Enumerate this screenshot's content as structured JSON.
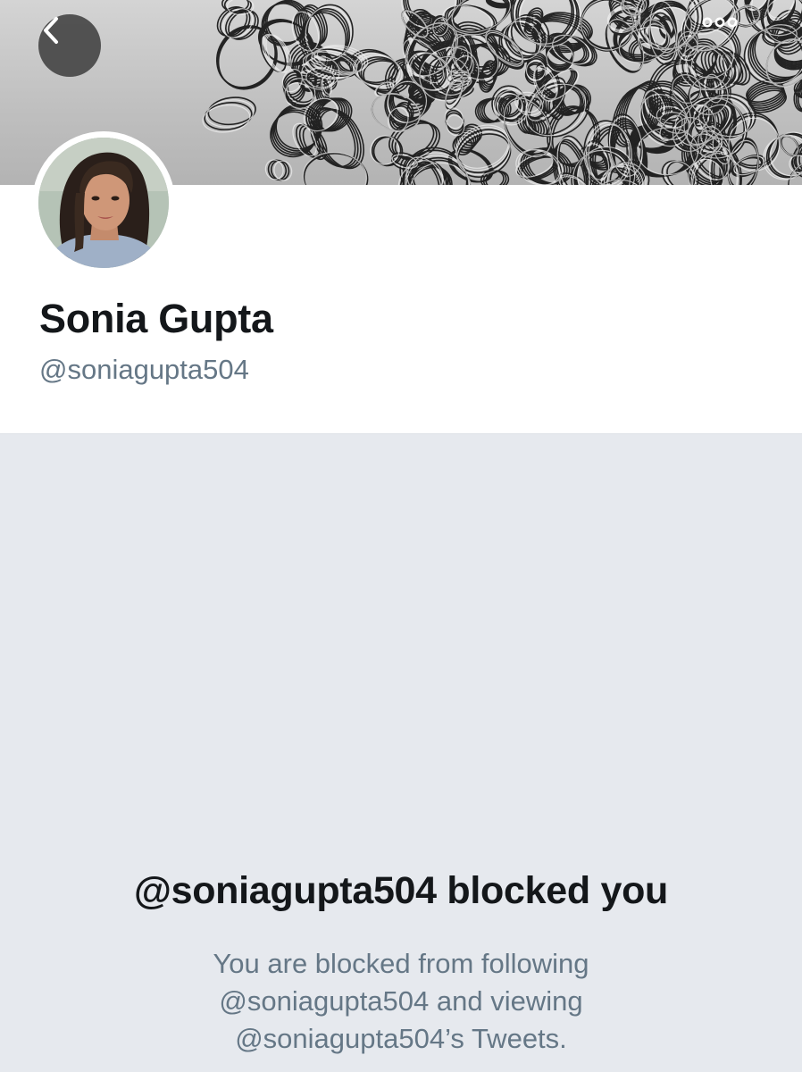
{
  "header": {
    "back_icon": "chevron-left-icon",
    "more_icon": "more-horizontal-icon"
  },
  "profile": {
    "display_name": "Sonia Gupta",
    "handle": "@soniagupta504"
  },
  "blocked": {
    "title": "@soniagupta504 blocked you",
    "description_lines": [
      "You are blocked from following",
      "@soniagupta504 and viewing",
      "@soniagupta504’s Tweets."
    ]
  },
  "colors": {
    "primary_text": "#14171a",
    "secondary_text": "#657786",
    "background_gray": "#e6e9ee",
    "surface": "#ffffff"
  }
}
